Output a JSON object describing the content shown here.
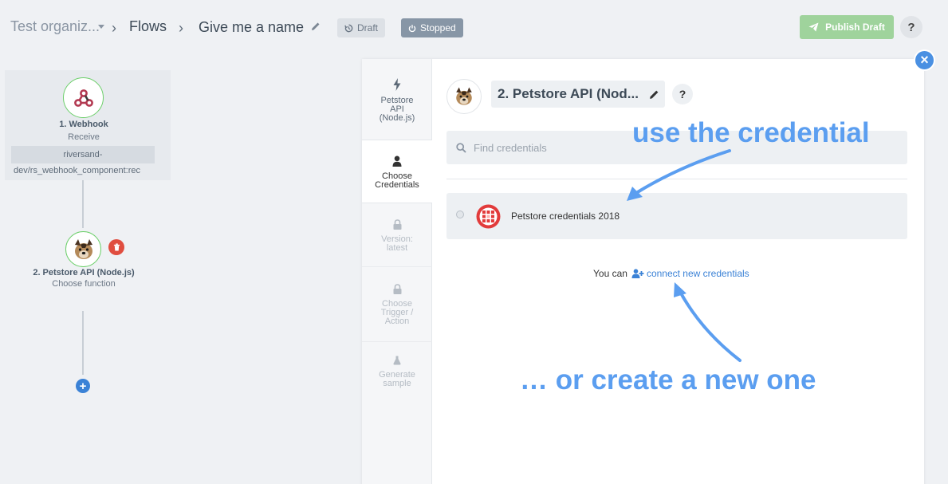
{
  "header": {
    "org": "Test organiz...",
    "flows": "Flows",
    "flow_name": "Give me a name",
    "draft_badge": "Draft",
    "stopped_badge": "Stopped",
    "publish_label": "Publish Draft",
    "help": "?"
  },
  "canvas": {
    "node1": {
      "title": "1. Webhook",
      "subtitle": "Receive",
      "code_line1": "riversand-",
      "code_line2": "dev/rs_webhook_component:rec"
    },
    "node2": {
      "title": "2. Petstore API (Node.js)",
      "subtitle": "Choose function"
    },
    "add_step": "+"
  },
  "panel": {
    "close": "×",
    "steps": [
      {
        "label_lines": [
          "Petstore",
          "API",
          "(Node.js)"
        ],
        "icon": "bolt-icon",
        "state": "normal"
      },
      {
        "label_lines": [
          "Choose",
          "Credentials"
        ],
        "icon": "user-icon",
        "state": "active"
      },
      {
        "label_lines": [
          "Version:",
          "latest"
        ],
        "icon": "lock-icon",
        "state": "disabled"
      },
      {
        "label_lines": [
          "Choose",
          "Trigger /",
          "Action"
        ],
        "icon": "lock-icon",
        "state": "disabled"
      },
      {
        "label_lines": [
          "Generate",
          "sample"
        ],
        "icon": "flask-icon",
        "state": "disabled"
      }
    ],
    "component_title": "2. Petstore API (Nod...",
    "help": "?",
    "search_placeholder": "Find credentials",
    "credential_name": "Petstore credentials 2018",
    "connect_prefix": "You can",
    "connect_link": "connect new credentials"
  },
  "annotations": {
    "top": "use the credential",
    "bottom": "… or create a new one"
  },
  "colors": {
    "accent": "#3b82d6",
    "annotation": "#5b9ef0",
    "publish": "#9fd39c",
    "stopped": "#8796a6",
    "delete": "#e04d3f",
    "node_ring": "#6ccf6a"
  }
}
